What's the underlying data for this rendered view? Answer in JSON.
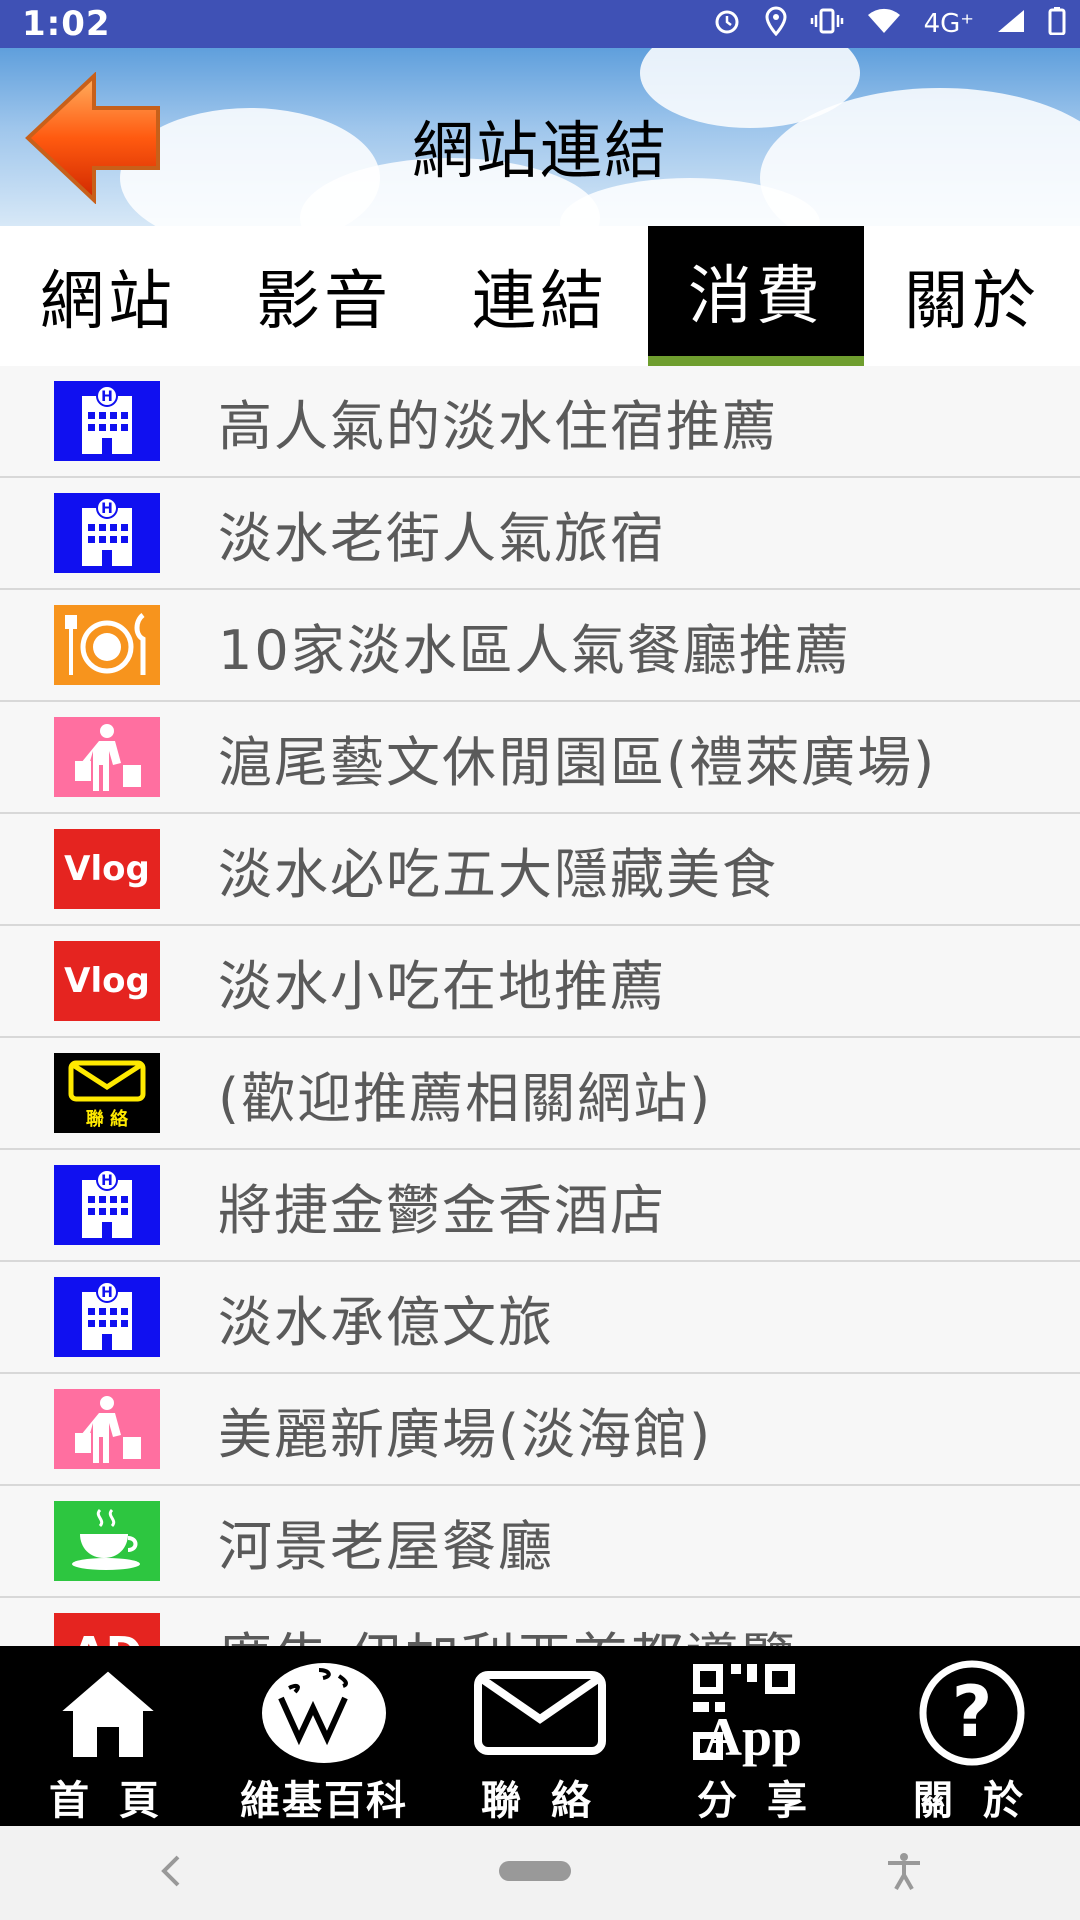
{
  "status": {
    "time": "1:02",
    "network": "4G⁺"
  },
  "header": {
    "title": "網站連結"
  },
  "tabs": [
    {
      "label": "網站",
      "active": false
    },
    {
      "label": "影音",
      "active": false
    },
    {
      "label": "連結",
      "active": false
    },
    {
      "label": "消費",
      "active": true
    },
    {
      "label": "關於",
      "active": false
    }
  ],
  "list": [
    {
      "icon": "hotel-icon",
      "label": "高人氣的淡水住宿推薦"
    },
    {
      "icon": "hotel-icon",
      "label": "淡水老街人氣旅宿"
    },
    {
      "icon": "restaurant-icon",
      "label": "10家淡水區人氣餐廳推薦"
    },
    {
      "icon": "shopping-icon",
      "label": "滬尾藝文休閒園區(禮萊廣場)"
    },
    {
      "icon": "vlog-icon",
      "icon_text": "Vlog",
      "label": "淡水必吃五大隱藏美食"
    },
    {
      "icon": "vlog-icon",
      "icon_text": "Vlog",
      "label": "淡水小吃在地推薦"
    },
    {
      "icon": "mail-icon",
      "icon_text": "聯 絡",
      "label": "(歡迎推薦相關網站)"
    },
    {
      "icon": "hotel-icon",
      "label": "將捷金鬱金香酒店"
    },
    {
      "icon": "hotel-icon",
      "label": "淡水承億文旅"
    },
    {
      "icon": "shopping-icon",
      "label": "美麗新廣場(淡海館)"
    },
    {
      "icon": "coffee-icon",
      "label": "河景老屋餐廳"
    },
    {
      "icon": "ad-icon",
      "icon_text": "AD",
      "label": "廣告 伊加利亞首都導覽"
    }
  ],
  "bottom_nav": [
    {
      "icon": "home-icon",
      "label": "首 頁"
    },
    {
      "icon": "wikipedia-icon",
      "label": "維基百科"
    },
    {
      "icon": "mail-icon",
      "label": "聯 絡"
    },
    {
      "icon": "qr-app-icon",
      "icon_text": "App",
      "label": "分 享"
    },
    {
      "icon": "help-icon",
      "icon_text": "?",
      "label": "關 於"
    }
  ],
  "colors": {
    "statusbar": "#3f51b5",
    "hotel": "#1010f0",
    "restaurant": "#f7941d",
    "shopping": "#ff6fa0",
    "vlog": "#e52420",
    "coffee": "#2dc640",
    "active_tab_underline": "#6f9e2f"
  }
}
